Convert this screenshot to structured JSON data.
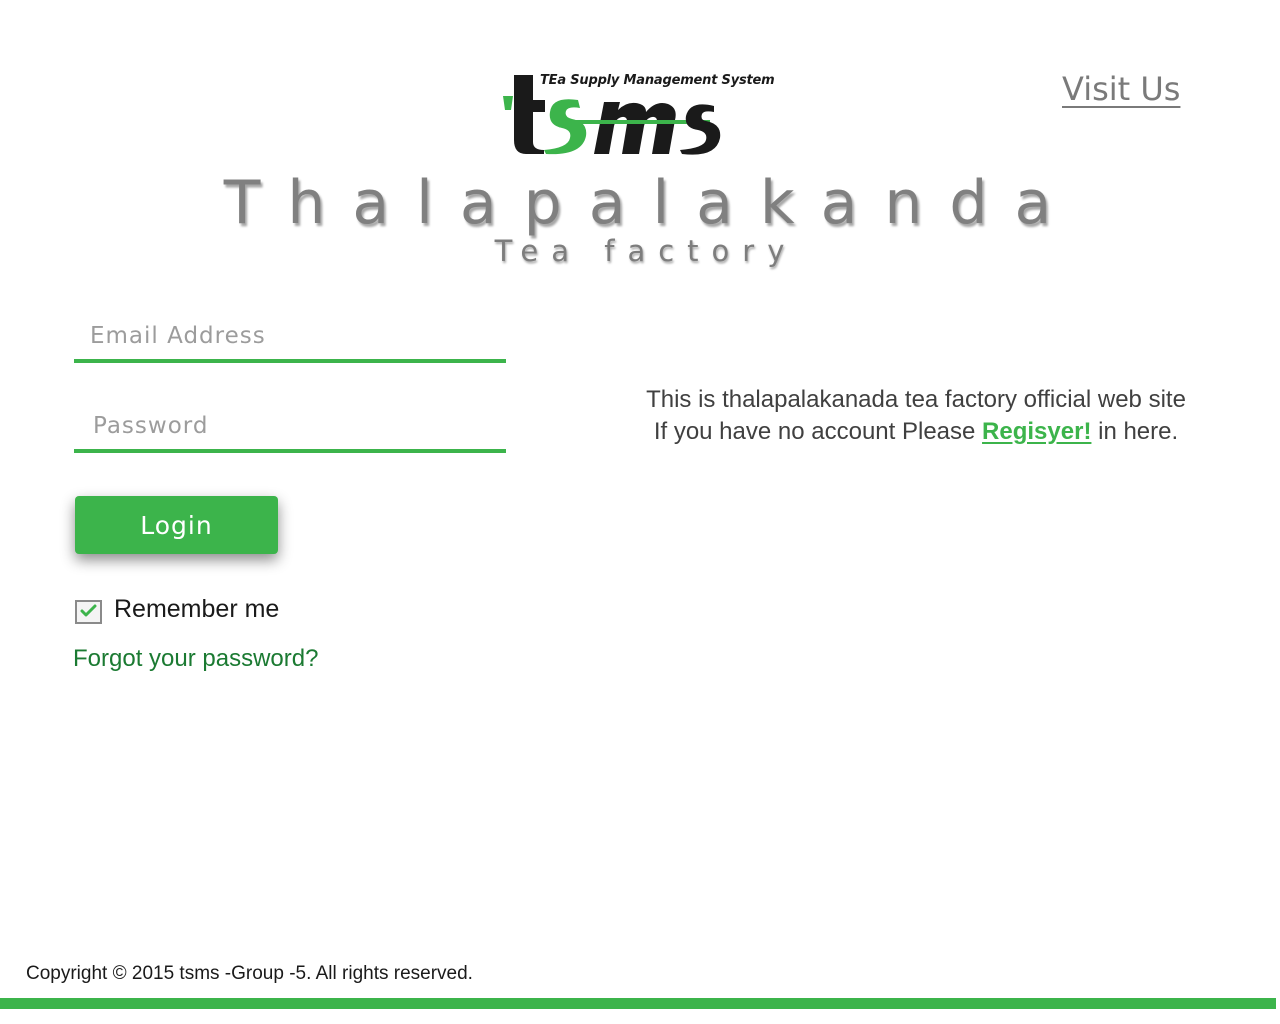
{
  "logo": {
    "text": "tsms",
    "tagline": "TEa Supply Management System"
  },
  "nav": {
    "visit_us": "Visit Us"
  },
  "header": {
    "factory_name": "Thalapalakanda",
    "factory_subtitle": "Tea factory"
  },
  "login_form": {
    "email_placeholder": "Email Address",
    "password_placeholder": "Password",
    "login_button": "Login",
    "remember_me": "Remember me",
    "remember_checked": true,
    "forgot_password": "Forgot your password?"
  },
  "info": {
    "line1": "This is thalapalakanada tea factory official web site",
    "line2_prefix": "If you have no account Please",
    "register_link": "Regisyer!",
    "line2_suffix": "in here."
  },
  "footer": {
    "copyright": "Copyright © 2015 tsms -Group -5. All rights reserved."
  },
  "colors": {
    "accent": "#3cb44b",
    "link_dark": "#1b7a32",
    "gray_text": "#808080"
  }
}
